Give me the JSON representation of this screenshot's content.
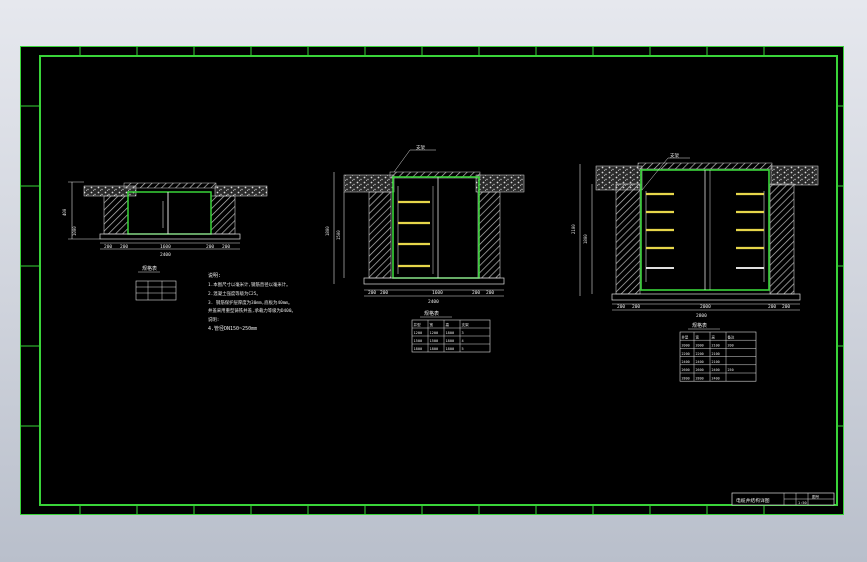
{
  "colors": {
    "background": "#000000",
    "frame": "#39d439",
    "line": "#ffffff",
    "pipe": "#ffffff",
    "tray": "#e6d64a",
    "hatch": "#cfcfcf"
  },
  "drawing": {
    "left_section": {
      "table_title": "规格表",
      "dims_bottom": [
        "200",
        "200",
        "1600",
        "200",
        "200"
      ],
      "dim_total": "2400",
      "dim_left": [
        "400",
        "1000"
      ]
    },
    "notes": {
      "title": "说明:",
      "lines": [
        "1.本图尺寸以毫米计,钢筋直径以毫米计。",
        "2.混凝土强度等级为C25。",
        "3.    钢筋保护层厚度为30mm,底板为40mm。",
        "   井盖采用重型铸铁井盖,承载力等级为D400。",
        "   说明:",
        "4.管径DN150~250mm"
      ]
    },
    "middle_section": {
      "label": "支架",
      "dims_bottom": [
        "200",
        "200",
        "1600",
        "200",
        "200"
      ],
      "dim_total": "2400",
      "dim_left": [
        "1800",
        "1500"
      ]
    },
    "right_section": {
      "label": "支架",
      "dims_bottom": [
        "200",
        "200",
        "2000",
        "200",
        "200"
      ],
      "dim_total": "2800",
      "dim_left": [
        "2100",
        "1800"
      ]
    },
    "tables": {
      "middle": {
        "title": "规格表",
        "rows": [
          [
            "井型",
            "宽",
            "高",
            "支架"
          ],
          [
            "1200",
            "1200",
            "1800",
            "3"
          ],
          [
            "1500",
            "1500",
            "1800",
            "4"
          ],
          [
            "1800",
            "1800",
            "1800",
            "5"
          ]
        ]
      },
      "right": {
        "title": "规格表",
        "rows": [
          [
            "井型",
            "宽",
            "高",
            "备注"
          ],
          [
            "2000",
            "2000",
            "2100",
            "200"
          ],
          [
            "2200",
            "2200",
            "2100",
            ""
          ],
          [
            "2400",
            "2400",
            "2100",
            ""
          ],
          [
            "2600",
            "2600",
            "2400",
            "250"
          ],
          [
            "2800",
            "2800",
            "2400",
            ""
          ]
        ]
      }
    },
    "title_block": {
      "name": "电缆井结构详图",
      "scale": "1:50",
      "sheet": "图号"
    }
  }
}
